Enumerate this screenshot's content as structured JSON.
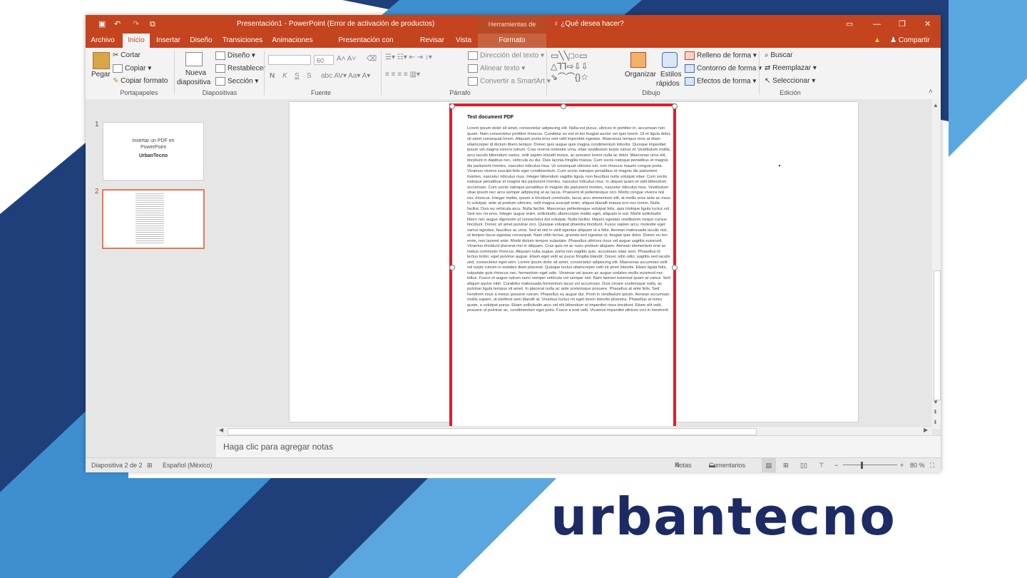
{
  "brand": {
    "name": "urbantecno",
    "color": "#1c2b63"
  },
  "colors": {
    "accent": "#c4441f",
    "pdf_highlight": "#dd1e2b",
    "stripe_dark": "#1f3f7a",
    "stripe_light": "#3d8fd0"
  },
  "titlebar": {
    "title": "Presentación1 - PowerPoint (Error de activación de productos)",
    "contextual_group": "Herramientas de imagen",
    "tell_me": "¿Qué desea hacer?",
    "share": "Compartir",
    "quick_access_icons": [
      "save-icon",
      "undo-icon",
      "redo-icon",
      "start-presentation-icon"
    ],
    "window_controls": [
      "ribbon-display-icon",
      "minimize-icon",
      "maximize-icon",
      "close-icon"
    ]
  },
  "tabs": [
    "Archivo",
    "Inicio",
    "Insertar",
    "Diseño",
    "Transiciones",
    "Animaciones",
    "Presentación con diapositivas",
    "Revisar",
    "Vista",
    "Formato"
  ],
  "ribbon": {
    "clipboard": {
      "paste": "Pegar",
      "cut": "Cortar",
      "copy": "Copiar",
      "format_painter": "Copiar formato",
      "group": "Portapapeles"
    },
    "slides": {
      "new_slide_1": "Nueva",
      "new_slide_2": "diapositiva",
      "layout": "Diseño",
      "reset": "Restablecer",
      "section": "Sección",
      "group": "Diapositivas"
    },
    "font": {
      "size": "60",
      "group": "Fuente",
      "buttons": [
        "N",
        "K",
        "S",
        "S"
      ]
    },
    "paragraph": {
      "text_direction": "Dirección del texto",
      "align_text": "Alinear texto",
      "smartart": "Convertir a SmartArt",
      "group": "Párrafo"
    },
    "drawing": {
      "arrange": "Organizar",
      "styles_1": "Estilos",
      "styles_2": "rápidos",
      "fill": "Relleno de forma",
      "outline": "Contorno de forma",
      "effects": "Efectos de forma",
      "group": "Dibujo"
    },
    "editing": {
      "find": "Buscar",
      "replace": "Reemplazar",
      "select": "Seleccionar",
      "group": "Edición"
    }
  },
  "slides": [
    {
      "number": "1",
      "line1": "Insertar un PDF en",
      "line2": "PowerPoint",
      "line3": "UrbanTecno"
    },
    {
      "number": "2"
    }
  ],
  "pdf": {
    "title": "Test document PDF",
    "body": "Lorem ipsum dolor sit amet, consectetur adipiscing elit. Nulla est purus, ultrices in porttitor in, accumsan non quam. Nam consectetur porttitor rhoncus. Curabitur eu est et leo feugiat auctor vel quis lorem. Ut et ligula dolor, sit amet consequat lorem. Aliquam porta eros sed velit imperdiet egestas. Maecenas tempus eros at diam ullamcorper id dictum libero tempor. Donec quis augue quis magna condimentum lobortis. Quisque imperdiet ipsum vel magna viverra rutrum. Cras viverra molestie urna, vitae vestibulum turpis varius id. Vestibulum mollis, arcu iaculis bibendum varius, velit sapien blandit metus, ac posuere lorem nulla ac dolor. Maecenas urna elit, tincidunt in dapibus nec, vehicula eu dui. Duis lacinia fringilla massa. Cum sociis natoque penatibus et magnis dis parturient montes, nascetur ridiculus mus. Ut consequat ultricies est, non rhoncus mauris congue porta. Vivamus viverra suscipit felis eget condimentum. Cum sociis natoque penatibus et magnis dis parturient montes, nascetur ridiculus mus. Integer bibendum sagittis ligula, non faucibus nulla volutpat vitae. Cum sociis natoque penatibus et magnis dis parturient montes, nascetur ridiculus mus. In aliquet quam et velit bibendum accumsan. Cum sociis natoque penatibus et magnis dis parturient montes, nascetur ridiculus mus. Vestibulum vitae ipsum nec arcu semper adipiscing at ac lacus. Praesent id pellentesque orci. Morbi congue viverra nisl nec rhoncus. Integer mattis, ipsum a tincidunt commodo, lacus arcu elementum elit, at mollis eros ante ac risus. In volutpat, ante at pretium ultricies, velit magna suscipit enim, aliquet blandit massa orci nec lorem. Nulla facilisi. Duis eu vehicula arcu. Nulla facilisi. Maecenas pellentesque volutpat felis, quis tristique ligula luctus vel. Sed nec mi eros. Integer augue enim, sollicitudin ullamcorper mattis eget, aliquam in est. Morbi sollicitudin libero nec augue dignissim ut consectetur dui volutpat. Nulla facilisi. Mauris egestas vestibulum neque cursus tincidunt. Donec sit amet pulvinar orci. Quisque volutpat pharetra tincidunt. Fusce sapien arcu, molestie eget varius egestas, faucibus ac urna. Sed at nisi in velit egestas aliquam ut a felis. Aenean malesuada iaculis nisl, ut tempor lacus egestas consequat. Nam nibh lectus, gravida sed egestas ut, feugiat quis dolor. Donec eu leo enim, non laoreet ante. Morbi dictum tempor vulputate. Phasellus ultricies risus vel augue sagittis euismod. Vivamus tincidunt placerat nisi in aliquam. Cras quis mi ac nunc pretium aliquam. Aenean elementum erat ac metus commodo rhoncus. Aliquam nulla augue, porta non sagittis quis, accumsan vitae sem. Phasellus id lectus tortor, eget pulvinar augue. Etiam eget velit ac purus fringilla blandit. Donec odio odio, sagittis sed iaculis sed, consectetur eget sem. Lorem ipsum dolor sit amet, consectetur adipiscing elit. Maecenas accumsan velit vel turpis rutrum in sodales diam placerat. Quisque luctus ullamcorper velit sit amet lobortis. Etiam ligula felis, vulputate quis rhoncus nec, fermentum eget odio. Vivamus vel ipsum ac augue sodales mollis euismod nec tellus. Fusce et augue rutrum nunc semper vehicula vel semper nisl. Nam laoreet euismod quam at varius. Sed aliquet auctor nibh. Curabitur malesuada fermentum lacus vel accumsan. Duis ornare scelerisque nulla, ac pulvinar ligula tempus sit amet. In placerat nulla ac ante scelerisque posuere. Phasellus at ante felis. Sed hendrerit risus a metus posuere rutrum. Phasellus eu augue dui. Proin in vestibulum ipsum. Aenean accumsan mollis sapien, ut eleifend sem blandit at. Vivamus luctus mi eget lorem lobortis pharetra. Phasellus at tortor quam, a volutpat purus. Etiam sollicitudin arcu vel elit bibendum et imperdiet risus tincidunt. Etiam elit velit, posuere ut pulvinar ac, condimentum eget justo. Fusce a erat velit. Vivamus imperdiet ultrices orci in hendrerit."
  },
  "notes": {
    "placeholder": "Haga clic para agregar notas"
  },
  "status": {
    "slide": "Diapositiva 2 de 2",
    "language": "Español (México)",
    "notes": "Notas",
    "comments": "Comentarios",
    "zoom": "80 %"
  }
}
